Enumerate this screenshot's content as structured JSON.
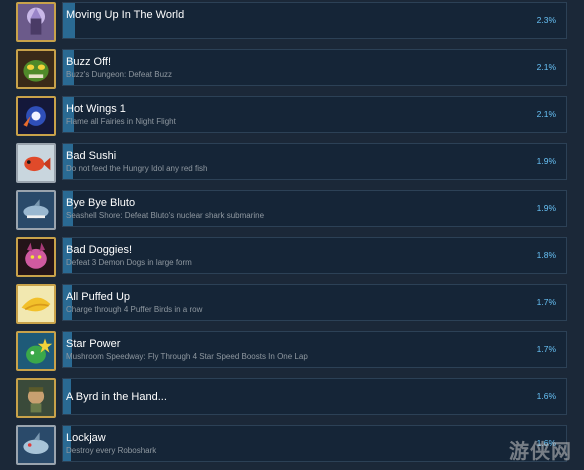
{
  "colors": {
    "background": "#1b2838",
    "row_bg": "#152537",
    "row_border": "#2c4156",
    "progress": "#2a6a93",
    "title": "#ffffff",
    "description": "#8f98a0",
    "percent": "#67c1f5",
    "icon_border": "#c8a24a"
  },
  "achievements": [
    {
      "title": "Moving Up In The World",
      "description": "",
      "percent": "2.3%",
      "progress": 0.023,
      "icon": "castle-icon"
    },
    {
      "title": "Buzz Off!",
      "description": "Buzz's Dungeon: Defeat Buzz",
      "percent": "2.1%",
      "progress": 0.021,
      "icon": "buzz-icon"
    },
    {
      "title": "Hot Wings 1",
      "description": "Flame all Fairies in Night Flight",
      "percent": "2.1%",
      "progress": 0.021,
      "icon": "flame-wings-icon"
    },
    {
      "title": "Bad Sushi",
      "description": "Do not feed the Hungry Idol any red fish",
      "percent": "1.9%",
      "progress": 0.019,
      "icon": "red-fish-icon"
    },
    {
      "title": "Bye Bye Bluto",
      "description": "Seashell Shore: Defeat Bluto's nuclear shark submarine",
      "percent": "1.9%",
      "progress": 0.019,
      "icon": "shark-sub-icon"
    },
    {
      "title": "Bad Doggies!",
      "description": "Defeat 3 Demon Dogs in large form",
      "percent": "1.8%",
      "progress": 0.018,
      "icon": "demon-dog-icon"
    },
    {
      "title": "All Puffed Up",
      "description": "Charge through 4 Puffer Birds in a row",
      "percent": "1.7%",
      "progress": 0.017,
      "icon": "puffer-bird-icon"
    },
    {
      "title": "Star Power",
      "description": "Mushroom Speedway: Fly Through 4 Star Speed Boosts In One Lap",
      "percent": "1.7%",
      "progress": 0.017,
      "icon": "star-dragon-icon"
    },
    {
      "title": "A Byrd in the Hand...",
      "description": "",
      "percent": "1.6%",
      "progress": 0.016,
      "icon": "byrd-icon"
    },
    {
      "title": "Lockjaw",
      "description": "Destroy every Roboshark",
      "percent": "1.6%",
      "progress": 0.016,
      "icon": "roboshark-icon"
    }
  ],
  "watermark": "游侠网"
}
